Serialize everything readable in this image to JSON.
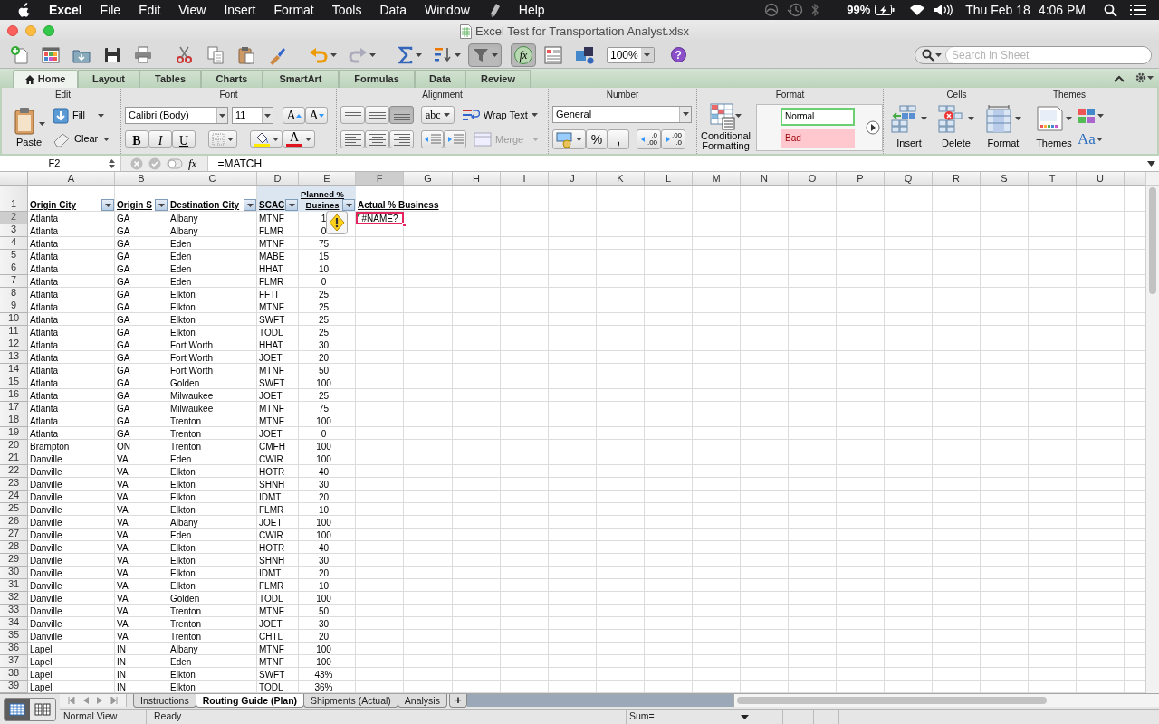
{
  "menu_bar": {
    "app": "Excel",
    "menus": [
      {
        "kind": "menu",
        "label": "File"
      },
      {
        "kind": "menu",
        "label": "Edit"
      },
      {
        "kind": "menu",
        "label": "View"
      },
      {
        "kind": "menu",
        "label": "Insert"
      },
      {
        "kind": "menu",
        "label": "Format"
      },
      {
        "kind": "menu",
        "label": "Tools"
      },
      {
        "kind": "menu",
        "label": "Data"
      },
      {
        "kind": "menu",
        "label": "Window"
      },
      {
        "kind": "script"
      },
      {
        "kind": "menu",
        "label": "Help"
      }
    ],
    "battery": "99%",
    "date": "Thu Feb 18",
    "time": "4:06 PM"
  },
  "window": {
    "title": "Excel Test for Transportation Analyst.xlsx"
  },
  "toolbar": {
    "buttons": [
      {
        "kind": "new",
        "on": false
      },
      {
        "kind": "gallery",
        "on": false
      },
      {
        "kind": "open",
        "on": false
      },
      {
        "kind": "save",
        "on": false
      },
      {
        "kind": "print",
        "on": false
      },
      {
        "kind": "cut",
        "on": false
      },
      {
        "kind": "copy",
        "on": false
      },
      {
        "kind": "paste",
        "on": false
      },
      {
        "kind": "brush",
        "on": false
      },
      {
        "kind": "undo",
        "on": false
      },
      {
        "kind": "redo",
        "on": false
      },
      {
        "kind": "sum",
        "on": false
      },
      {
        "kind": "sort",
        "on": false
      },
      {
        "kind": "filter",
        "on": true
      },
      {
        "kind": "fx",
        "label": "fx",
        "on": true
      },
      {
        "kind": "toolbox",
        "on": false
      },
      {
        "kind": "media",
        "on": false
      },
      {
        "kind": "zoom",
        "label": "100%",
        "on": false
      },
      {
        "kind": "help",
        "label": "?",
        "on": false
      }
    ],
    "search": {
      "placeholder": "Search in Sheet"
    }
  },
  "ribbon": {
    "tabs": [
      {
        "label": "Home",
        "selected": true
      },
      {
        "label": "Layout",
        "selected": false
      },
      {
        "label": "Tables",
        "selected": false
      },
      {
        "label": "Charts",
        "selected": false
      },
      {
        "label": "SmartArt",
        "selected": false
      },
      {
        "label": "Formulas",
        "selected": false
      },
      {
        "label": "Data",
        "selected": false
      },
      {
        "label": "Review",
        "selected": false
      }
    ],
    "groups": [
      {
        "kind": "edit",
        "title": "Edit",
        "paste": "Paste",
        "fill": "Fill",
        "clear": "Clear"
      },
      {
        "kind": "font",
        "title": "Font",
        "font_name": "Calibri (Body)",
        "font_size": "11",
        "grow": "A",
        "shrink": "A",
        "bold": "B",
        "italic": "I",
        "underline": "U",
        "font_color": "A"
      },
      {
        "kind": "alignment",
        "title": "Alignment",
        "vertical": [
          {
            "kind": "top",
            "selected": false
          },
          {
            "kind": "middle",
            "selected": false
          },
          {
            "kind": "bottom",
            "selected": true
          }
        ],
        "orientation": "abc",
        "wrap_text": "Wrap Text",
        "merge": {
          "label": "Merge",
          "disabled": true
        }
      },
      {
        "kind": "number",
        "title": "Number",
        "format": "General",
        "percent": "%",
        "comma": ",",
        "decrease_decimal": [
          ".0",
          ".00"
        ],
        "increase_decimal": [
          ".00",
          ".0"
        ]
      },
      {
        "kind": "format",
        "title": "Format",
        "conditional": "Conditional Formatting",
        "styles": [
          {
            "kind": "normal",
            "label": "Normal",
            "selected": true
          },
          {
            "kind": "bad",
            "label": "Bad",
            "selected": false
          }
        ]
      },
      {
        "kind": "cells",
        "title": "Cells",
        "buttons": [
          {
            "kind": "insert",
            "label": "Insert"
          },
          {
            "kind": "delete",
            "label": "Delete"
          },
          {
            "kind": "format",
            "label": "Format"
          }
        ]
      },
      {
        "kind": "themes",
        "title": "Themes",
        "themes": "Themes",
        "fonts": "Aa"
      }
    ]
  },
  "formula_bar": {
    "name_box": "F2",
    "fx": "fx",
    "formula": "=MATCH"
  },
  "sheet": {
    "columns": [
      {
        "label": "A",
        "selected": false
      },
      {
        "label": "B",
        "selected": false
      },
      {
        "label": "C",
        "selected": false
      },
      {
        "label": "D",
        "selected": false
      },
      {
        "label": "E",
        "selected": false
      },
      {
        "label": "F",
        "selected": true
      },
      {
        "label": "G",
        "selected": false
      },
      {
        "label": "H",
        "selected": false
      },
      {
        "label": "I",
        "selected": false
      },
      {
        "label": "J",
        "selected": false
      },
      {
        "label": "K",
        "selected": false
      },
      {
        "label": "L",
        "selected": false
      },
      {
        "label": "M",
        "selected": false
      },
      {
        "label": "N",
        "selected": false
      },
      {
        "label": "O",
        "selected": false
      },
      {
        "label": "P",
        "selected": false
      },
      {
        "label": "Q",
        "selected": false
      },
      {
        "label": "R",
        "selected": false
      },
      {
        "label": "S",
        "selected": false
      },
      {
        "label": "T",
        "selected": false
      },
      {
        "label": "U",
        "selected": false
      }
    ],
    "header_row": {
      "number": "1",
      "selected": false,
      "cells": [
        {
          "text": "Origin City",
          "filter": true,
          "highlighted": false
        },
        {
          "text": "Origin S",
          "filter": true,
          "highlighted": false
        },
        {
          "text": "Destination City",
          "filter": true,
          "highlighted": false
        },
        {
          "text": "SCAC",
          "filter": true,
          "highlighted": true
        },
        {
          "text": "Planned %\nBusines",
          "filter": true,
          "highlighted": true
        },
        {
          "text": "Actual % Business",
          "filter": false,
          "highlighted": false
        }
      ]
    },
    "rows": [
      {
        "number": "2",
        "selected": true,
        "cells": [
          "Atlanta",
          "GA",
          "Albany",
          "MTNF",
          "1",
          "#NAME?"
        ]
      },
      {
        "number": "3",
        "selected": false,
        "cells": [
          "Atlanta",
          "GA",
          "Albany",
          "FLMR",
          "0",
          ""
        ]
      },
      {
        "number": "4",
        "selected": false,
        "cells": [
          "Atlanta",
          "GA",
          "Eden",
          "MTNF",
          "75",
          ""
        ]
      },
      {
        "number": "5",
        "selected": false,
        "cells": [
          "Atlanta",
          "GA",
          "Eden",
          "MABE",
          "15",
          ""
        ]
      },
      {
        "number": "6",
        "selected": false,
        "cells": [
          "Atlanta",
          "GA",
          "Eden",
          "HHAT",
          "10",
          ""
        ]
      },
      {
        "number": "7",
        "selected": false,
        "cells": [
          "Atlanta",
          "GA",
          "Eden",
          "FLMR",
          "0",
          ""
        ]
      },
      {
        "number": "8",
        "selected": false,
        "cells": [
          "Atlanta",
          "GA",
          "Elkton",
          "FFTI",
          "25",
          ""
        ]
      },
      {
        "number": "9",
        "selected": false,
        "cells": [
          "Atlanta",
          "GA",
          "Elkton",
          "MTNF",
          "25",
          ""
        ]
      },
      {
        "number": "10",
        "selected": false,
        "cells": [
          "Atlanta",
          "GA",
          "Elkton",
          "SWFT",
          "25",
          ""
        ]
      },
      {
        "number": "11",
        "selected": false,
        "cells": [
          "Atlanta",
          "GA",
          "Elkton",
          "TODL",
          "25",
          ""
        ]
      },
      {
        "number": "12",
        "selected": false,
        "cells": [
          "Atlanta",
          "GA",
          "Fort Worth",
          "HHAT",
          "30",
          ""
        ]
      },
      {
        "number": "13",
        "selected": false,
        "cells": [
          "Atlanta",
          "GA",
          "Fort Worth",
          "JOET",
          "20",
          ""
        ]
      },
      {
        "number": "14",
        "selected": false,
        "cells": [
          "Atlanta",
          "GA",
          "Fort Worth",
          "MTNF",
          "50",
          ""
        ]
      },
      {
        "number": "15",
        "selected": false,
        "cells": [
          "Atlanta",
          "GA",
          "Golden",
          "SWFT",
          "100",
          ""
        ]
      },
      {
        "number": "16",
        "selected": false,
        "cells": [
          "Atlanta",
          "GA",
          "Milwaukee",
          "JOET",
          "25",
          ""
        ]
      },
      {
        "number": "17",
        "selected": false,
        "cells": [
          "Atlanta",
          "GA",
          "Milwaukee",
          "MTNF",
          "75",
          ""
        ]
      },
      {
        "number": "18",
        "selected": false,
        "cells": [
          "Atlanta",
          "GA",
          "Trenton",
          "MTNF",
          "100",
          ""
        ]
      },
      {
        "number": "19",
        "selected": false,
        "cells": [
          "Atlanta",
          "GA",
          "Trenton",
          "JOET",
          "0",
          ""
        ]
      },
      {
        "number": "20",
        "selected": false,
        "cells": [
          "Brampton",
          "ON",
          "Trenton",
          "CMFH",
          "100",
          ""
        ]
      },
      {
        "number": "21",
        "selected": false,
        "cells": [
          "Danville",
          "VA",
          "Eden",
          "CWIR",
          "100",
          ""
        ]
      },
      {
        "number": "22",
        "selected": false,
        "cells": [
          "Danville",
          "VA",
          "Elkton",
          "HOTR",
          "40",
          ""
        ]
      },
      {
        "number": "23",
        "selected": false,
        "cells": [
          "Danville",
          "VA",
          "Elkton",
          "SHNH",
          "30",
          ""
        ]
      },
      {
        "number": "24",
        "selected": false,
        "cells": [
          "Danville",
          "VA",
          "Elkton",
          "IDMT",
          "20",
          ""
        ]
      },
      {
        "number": "25",
        "selected": false,
        "cells": [
          "Danville",
          "VA",
          "Elkton",
          "FLMR",
          "10",
          ""
        ]
      },
      {
        "number": "26",
        "selected": false,
        "cells": [
          "Danville",
          "VA",
          "Albany",
          "JOET",
          "100",
          ""
        ]
      },
      {
        "number": "27",
        "selected": false,
        "cells": [
          "Danville",
          "VA",
          "Eden",
          "CWIR",
          "100",
          ""
        ]
      },
      {
        "number": "28",
        "selected": false,
        "cells": [
          "Danville",
          "VA",
          "Elkton",
          "HOTR",
          "40",
          ""
        ]
      },
      {
        "number": "29",
        "selected": false,
        "cells": [
          "Danville",
          "VA",
          "Elkton",
          "SHNH",
          "30",
          ""
        ]
      },
      {
        "number": "30",
        "selected": false,
        "cells": [
          "Danville",
          "VA",
          "Elkton",
          "IDMT",
          "20",
          ""
        ]
      },
      {
        "number": "31",
        "selected": false,
        "cells": [
          "Danville",
          "VA",
          "Elkton",
          "FLMR",
          "10",
          ""
        ]
      },
      {
        "number": "32",
        "selected": false,
        "cells": [
          "Danville",
          "VA",
          "Golden",
          "TODL",
          "100",
          ""
        ]
      },
      {
        "number": "33",
        "selected": false,
        "cells": [
          "Danville",
          "VA",
          "Trenton",
          "MTNF",
          "50",
          ""
        ]
      },
      {
        "number": "34",
        "selected": false,
        "cells": [
          "Danville",
          "VA",
          "Trenton",
          "JOET",
          "30",
          ""
        ]
      },
      {
        "number": "35",
        "selected": false,
        "cells": [
          "Danville",
          "VA",
          "Trenton",
          "CHTL",
          "20",
          ""
        ]
      },
      {
        "number": "36",
        "selected": false,
        "cells": [
          "Lapel",
          "IN",
          "Albany",
          "MTNF",
          "100",
          ""
        ]
      },
      {
        "number": "37",
        "selected": false,
        "cells": [
          "Lapel",
          "IN",
          "Eden",
          "MTNF",
          "100",
          ""
        ]
      },
      {
        "number": "38",
        "selected": false,
        "cells": [
          "Lapel",
          "IN",
          "Elkton",
          "SWFT",
          "43%",
          ""
        ]
      },
      {
        "number": "39",
        "selected": false,
        "cells": [
          "Lapel",
          "IN",
          "Elkton",
          "TODL",
          "36%",
          ""
        ]
      }
    ]
  },
  "sheet_tabs": [
    {
      "label": "Instructions",
      "selected": false
    },
    {
      "label": "Routing Guide (Plan)",
      "selected": true
    },
    {
      "label": "Shipments (Actual)",
      "selected": false
    },
    {
      "label": "Analysis",
      "selected": false
    }
  ],
  "add_sheet": "+",
  "view_buttons": [
    {
      "kind": "normal",
      "selected": true
    },
    {
      "kind": "page-layout",
      "selected": false
    }
  ],
  "status_bar": {
    "view": "Normal View",
    "status": "Ready",
    "sum": "Sum="
  }
}
